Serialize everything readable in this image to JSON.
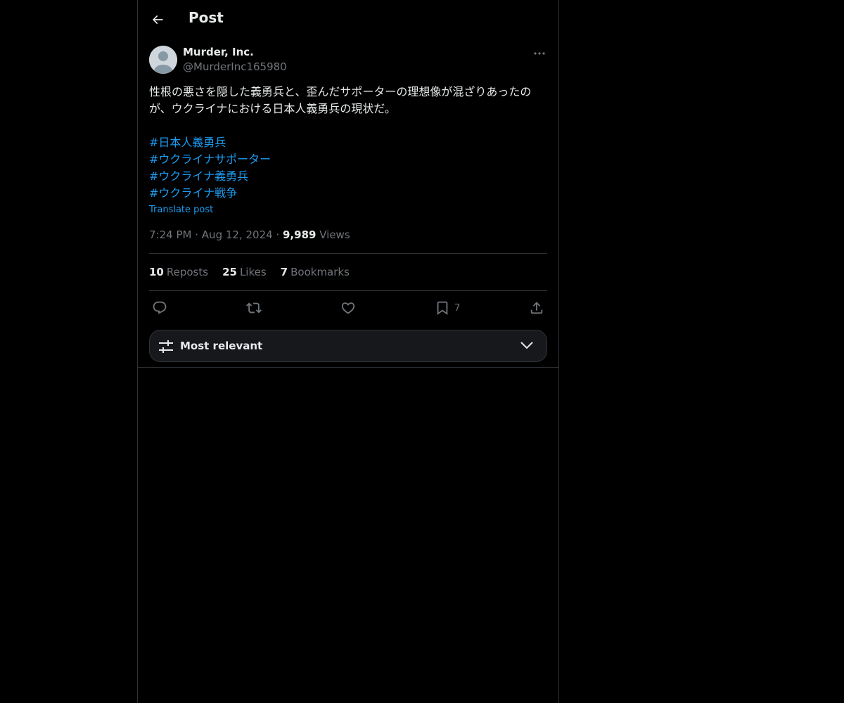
{
  "header": {
    "title": "Post"
  },
  "author": {
    "name": "Murder, Inc.",
    "handle": "@MurderInc165980"
  },
  "post": {
    "text": "性根の悪さを隠した義勇兵と、歪んだサポーターの理想像が混ざりあったのが、ウクライナにおける日本人義勇兵の現状だ。",
    "hashtags": [
      "#日本人義勇兵",
      "#ウクライナサポーター",
      "#ウクライナ義勇兵",
      "#ウクライナ戦争"
    ],
    "translate_label": "Translate post"
  },
  "meta": {
    "time": "7:24 PM",
    "separator": "·",
    "date": "Aug 12, 2024",
    "views_count": "9,989",
    "views_label": "Views"
  },
  "stats": {
    "reposts_count": "10",
    "reposts_label": "Reposts",
    "likes_count": "25",
    "likes_label": "Likes",
    "bookmarks_count": "7",
    "bookmarks_label": "Bookmarks"
  },
  "actions": {
    "icons": [
      "reply-icon",
      "repost-icon",
      "like-icon",
      "bookmark-icon",
      "share-icon"
    ],
    "bookmark_count": "7"
  },
  "sort": {
    "label": "Most relevant"
  },
  "colors": {
    "accent": "#1d9bf0",
    "background": "#000000",
    "muted": "#71767b",
    "border": "#2f3336"
  }
}
